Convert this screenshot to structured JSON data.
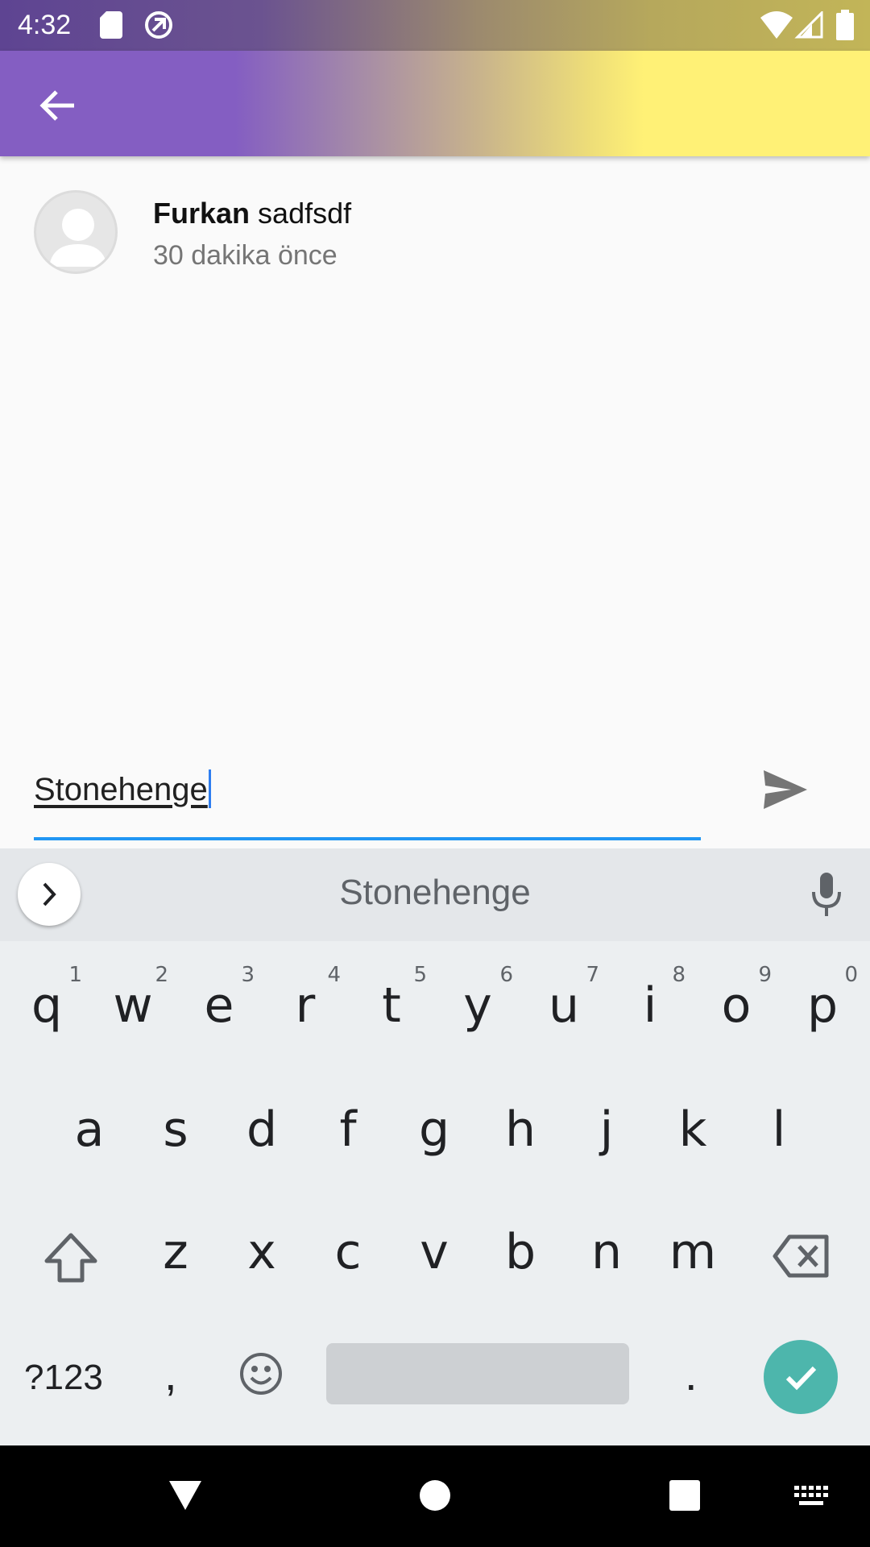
{
  "status_bar": {
    "time": "4:32"
  },
  "comment": {
    "author": "Furkan",
    "text": "sadfsdf",
    "time": "30 dakika önce"
  },
  "composer": {
    "value": "Stonehenge"
  },
  "keyboard": {
    "suggestion": "Stonehenge",
    "row1": [
      {
        "key": "q",
        "hint": "1"
      },
      {
        "key": "w",
        "hint": "2"
      },
      {
        "key": "e",
        "hint": "3"
      },
      {
        "key": "r",
        "hint": "4"
      },
      {
        "key": "t",
        "hint": "5"
      },
      {
        "key": "y",
        "hint": "6"
      },
      {
        "key": "u",
        "hint": "7"
      },
      {
        "key": "i",
        "hint": "8"
      },
      {
        "key": "o",
        "hint": "9"
      },
      {
        "key": "p",
        "hint": "0"
      }
    ],
    "row2": [
      "a",
      "s",
      "d",
      "f",
      "g",
      "h",
      "j",
      "k",
      "l"
    ],
    "row3": [
      "z",
      "x",
      "c",
      "v",
      "b",
      "n",
      "m"
    ],
    "symbols_label": "?123",
    "comma": ",",
    "period": ".",
    "accent_color": "#4db6ac"
  },
  "colors": {
    "input_underline": "#2196f3",
    "appbar_left": "#845ec2",
    "appbar_right": "#fff176"
  }
}
